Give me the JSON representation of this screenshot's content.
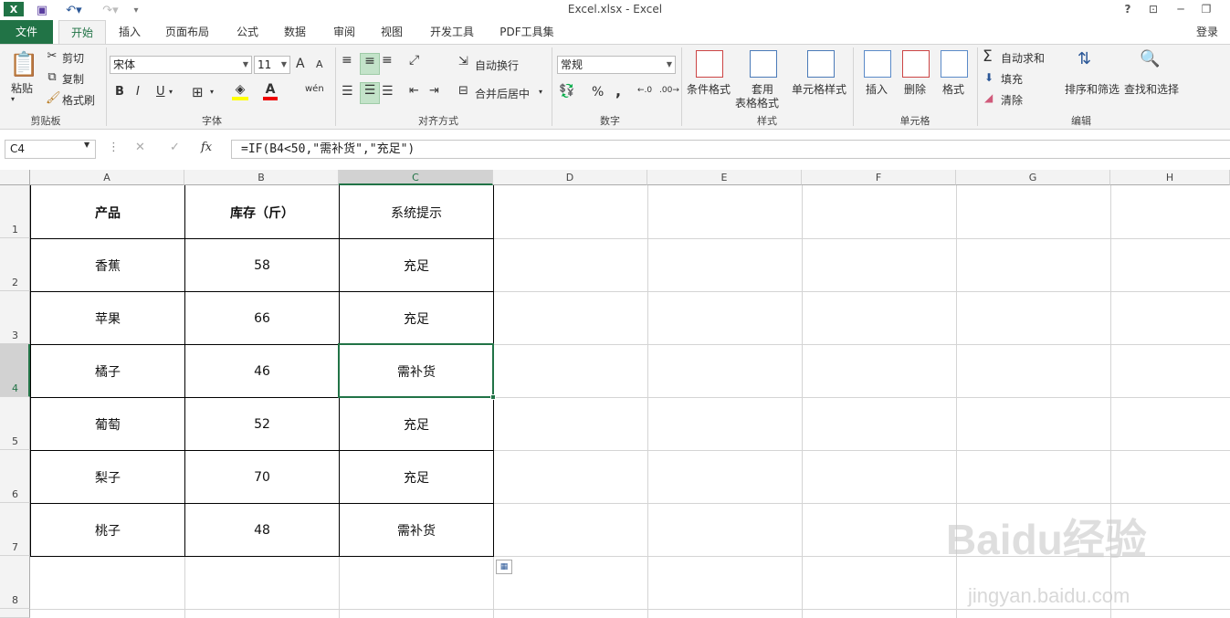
{
  "title_bar": {
    "title": "Excel.xlsx - Excel",
    "help": "?",
    "login": "登录"
  },
  "tabs": [
    "文件",
    "开始",
    "插入",
    "页面布局",
    "公式",
    "数据",
    "审阅",
    "视图",
    "开发工具",
    "PDF工具集"
  ],
  "ribbon": {
    "clipboard": {
      "paste": "粘贴",
      "cut": "剪切",
      "copy": "复制",
      "format_painter": "格式刷",
      "group": "剪贴板"
    },
    "font": {
      "name": "宋体",
      "size": "11",
      "bold": "B",
      "italic": "I",
      "underline": "U",
      "grow": "A",
      "shrink": "A",
      "group": "字体"
    },
    "alignment": {
      "wrap": "自动换行",
      "merge": "合并后居中",
      "group": "对齐方式"
    },
    "number": {
      "format": "常规",
      "percent": "%",
      "comma": ",",
      "group": "数字"
    },
    "styles": {
      "conditional": "条件格式",
      "table_1": "套用",
      "table_2": "表格格式",
      "cell_styles": "单元格样式",
      "group": "样式"
    },
    "cells": {
      "insert": "插入",
      "delete": "删除",
      "format": "格式",
      "group": "单元格"
    },
    "editing": {
      "autosum": "自动求和",
      "fill": "填充",
      "clear": "清除",
      "sort": "排序和筛选",
      "find": "查找和选择",
      "group": "编辑"
    }
  },
  "formula_bar": {
    "name_box": "C4",
    "fx": "fx",
    "formula": "=IF(B4<50,\"需补货\",\"充足\")"
  },
  "columns": [
    "A",
    "B",
    "C",
    "D",
    "E",
    "F",
    "G",
    "H"
  ],
  "rows": [
    "1",
    "2",
    "3",
    "4",
    "5",
    "6",
    "7",
    "8"
  ],
  "table": {
    "header": [
      "产品",
      "库存（斤）",
      "系统提示"
    ],
    "rows": [
      [
        "香蕉",
        "58",
        "充足"
      ],
      [
        "苹果",
        "66",
        "充足"
      ],
      [
        "橘子",
        "46",
        "需补货"
      ],
      [
        "葡萄",
        "52",
        "充足"
      ],
      [
        "梨子",
        "70",
        "充足"
      ],
      [
        "桃子",
        "48",
        "需补货"
      ]
    ]
  },
  "watermark": {
    "brand": "Baidu经验",
    "url": "jingyan.baidu.com"
  },
  "colors": {
    "excel_green": "#217346",
    "selected_header": "#d2d2d2",
    "ribbon_bg": "#f3f3f3",
    "grid_line": "#d4d4d4"
  }
}
